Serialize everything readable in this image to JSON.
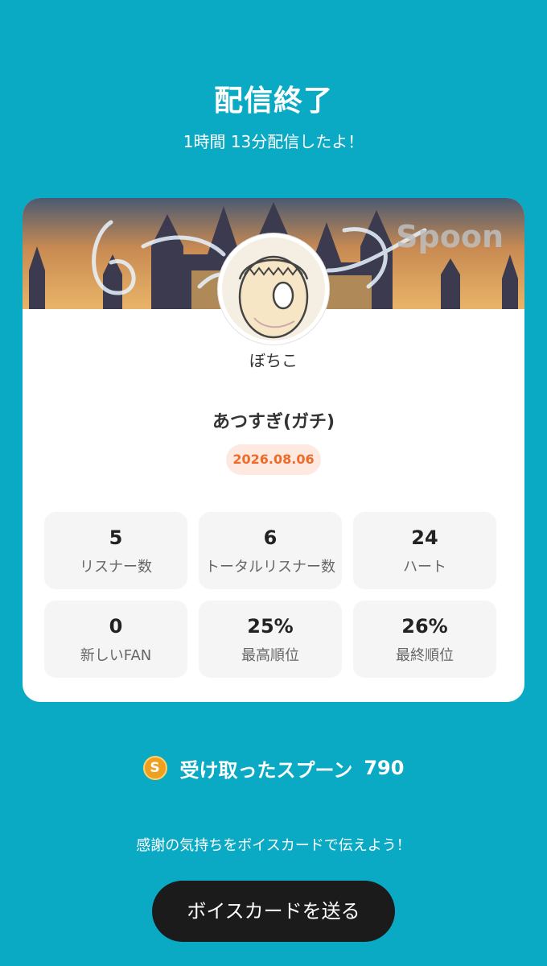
{
  "header": {
    "title": "配信終了",
    "subtitle": "1時間 13分配信したよ！"
  },
  "card": {
    "banner_watermark": "Spoon",
    "username": "ぼちこ",
    "live_title": "あつすぎ(ガチ)",
    "date": "2026.08.06",
    "stats": [
      {
        "value": "5",
        "label": "リスナー数"
      },
      {
        "value": "6",
        "label": "トータルリスナー数"
      },
      {
        "value": "24",
        "label": "ハート"
      },
      {
        "value": "0",
        "label": "新しいFAN"
      },
      {
        "value": "25%",
        "label": "最高順位"
      },
      {
        "value": "26%",
        "label": "最終順位"
      }
    ]
  },
  "spoons": {
    "icon": "spoon-coin-icon",
    "coin_letter": "S",
    "label": "受け取ったスプーン",
    "count": "790"
  },
  "footer": {
    "thanks_text": "感謝の気持ちをボイスカードで伝えよう！",
    "button_label": "ボイスカードを送る"
  },
  "colors": {
    "background": "#0aa9c4",
    "accent_orange": "#f06a2a",
    "button_dark": "#1b1b1b"
  }
}
